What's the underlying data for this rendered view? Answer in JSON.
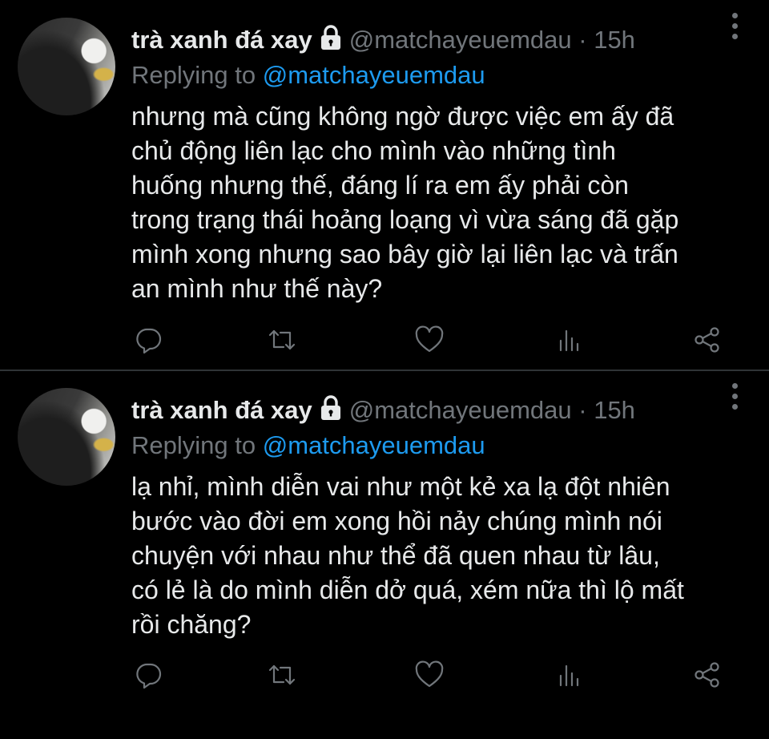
{
  "tweets": [
    {
      "display_name": "trà xanh đá xay",
      "handle": "@matchayeuemdau",
      "separator": "·",
      "time": "15h",
      "replying_prefix": "Replying to",
      "replying_to": "@matchayeuemdau",
      "text_lines": [
        "nhưng mà cũng không ngờ được việc em ấy đã",
        "chủ động liên lạc cho mình vào những tình",
        "huống nhưng thế, đáng lí ra em ấy phải còn",
        "trong trạng thái hoảng loạng vì vừa sáng đã gặp",
        "mình xong nhưng sao bây giờ lại liên lạc và trấn",
        "an mình như thế này?"
      ],
      "icons": [
        "lock-icon",
        "more-vertical-icon",
        "reply-icon",
        "retweet-icon",
        "heart-icon",
        "analytics-icon",
        "share-icon"
      ]
    },
    {
      "display_name": "trà xanh đá xay",
      "handle": "@matchayeuemdau",
      "separator": "·",
      "time": "15h",
      "replying_prefix": "Replying to",
      "replying_to": "@matchayeuemdau",
      "text_lines": [
        "lạ nhỉ, mình diễn vai như một kẻ xa lạ đột nhiên",
        "bước vào đời em xong hồi nảy chúng mình nói",
        "chuyện với nhau như thể đã quen nhau từ lâu,",
        "có lẻ là do mình diễn dở quá, xém nữa thì lộ mất",
        "rồi chăng?"
      ],
      "icons": [
        "lock-icon",
        "more-vertical-icon",
        "reply-icon",
        "retweet-icon",
        "heart-icon",
        "analytics-icon",
        "share-icon"
      ]
    }
  ],
  "colors": {
    "background": "#000000",
    "text": "#e7e9ea",
    "muted": "#71767b",
    "link": "#1d9bf0",
    "divider": "#2f3336"
  }
}
